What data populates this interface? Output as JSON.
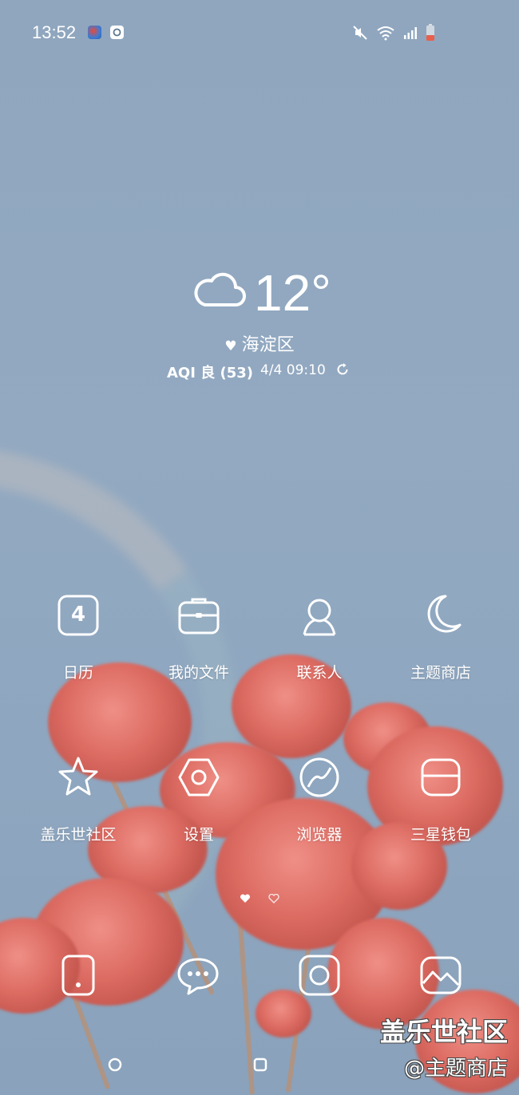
{
  "status_bar": {
    "time": "13:52",
    "icons": [
      "bird-notification-icon",
      "app-notification-icon",
      "mute-icon",
      "wifi-icon",
      "signal-icon",
      "battery-icon"
    ]
  },
  "weather": {
    "temperature": "12°",
    "condition_icon": "cloud-icon",
    "location": "海淀区",
    "aqi": "AQI 良 (53)",
    "updated": "4/4 09:10"
  },
  "apps": [
    {
      "label": "日历",
      "icon": "calendar-icon",
      "icon_text": "4"
    },
    {
      "label": "我的文件",
      "icon": "folder-briefcase-icon"
    },
    {
      "label": "联系人",
      "icon": "contacts-icon"
    },
    {
      "label": "主题商店",
      "icon": "moon-icon"
    },
    {
      "label": "盖乐世社区",
      "icon": "star-icon"
    },
    {
      "label": "设置",
      "icon": "gear-icon"
    },
    {
      "label": "浏览器",
      "icon": "browser-icon"
    },
    {
      "label": "三星钱包",
      "icon": "wallet-icon"
    }
  ],
  "dock": [
    {
      "icon": "phone-icon"
    },
    {
      "icon": "messages-icon"
    },
    {
      "icon": "camera-icon"
    },
    {
      "icon": "gallery-icon"
    }
  ],
  "page_indicator": {
    "pages": 2,
    "current": 1
  },
  "navigation": [
    "recents-button",
    "home-button"
  ],
  "watermark": {
    "line1": "盖乐世社区",
    "line2": "@主题商店"
  },
  "colors": {
    "icon_stroke": "#ffffff",
    "wallpaper_sky": "#8fa7c0",
    "rose": "#dc6b62"
  }
}
